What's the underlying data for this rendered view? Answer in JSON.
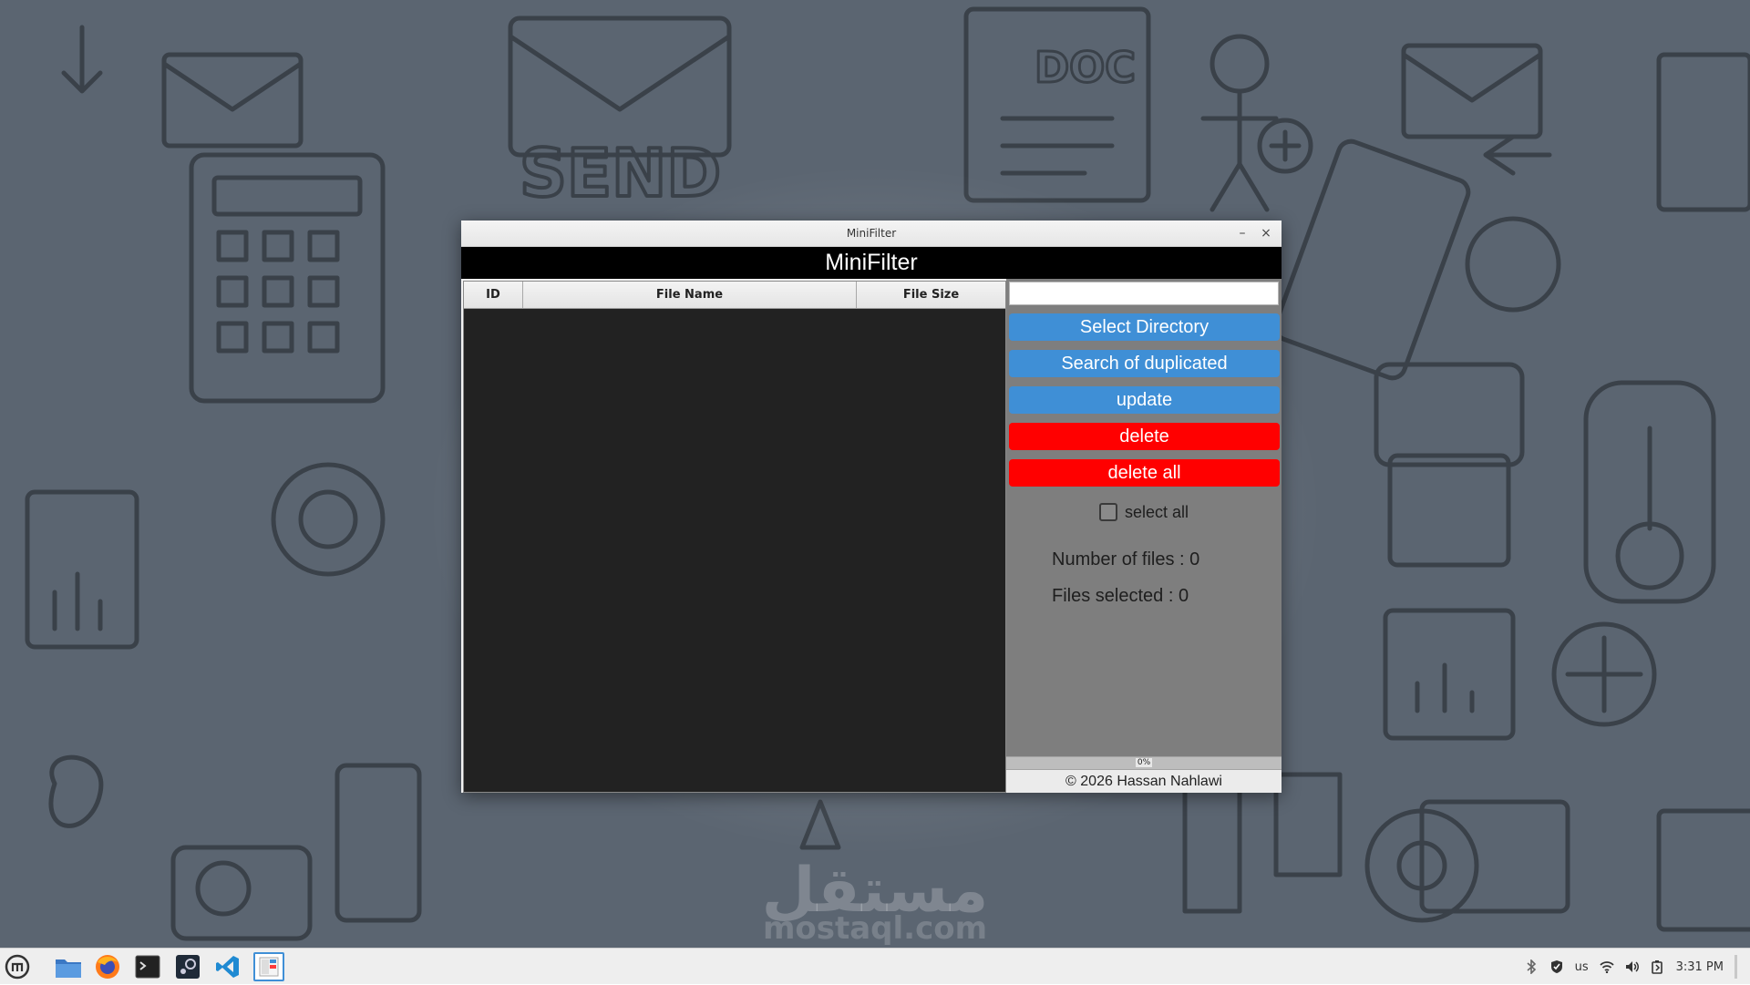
{
  "window": {
    "title": "MiniFilter",
    "minimize_glyph": "–",
    "close_glyph": "×"
  },
  "app": {
    "header": "MiniFilter"
  },
  "table": {
    "columns": [
      "ID",
      "File Name",
      "File Size"
    ],
    "rows": []
  },
  "side": {
    "search": {
      "value": "",
      "placeholder": ""
    },
    "buttons": {
      "select_directory": "Select Directory",
      "search_duplicated": "Search of duplicated",
      "update": "update",
      "delete": "delete",
      "delete_all": "delete all"
    },
    "select_all": {
      "label": "select all",
      "checked": false
    },
    "stats": {
      "number_of_files": "Number of files : 0",
      "files_selected": "Files selected : 0"
    },
    "progress": {
      "value": 0,
      "text": "0%"
    },
    "footer": "© 2026 Hassan Nahlawi"
  },
  "taskbar": {
    "apps": [
      "menu-icon",
      "files-icon",
      "firefox-icon",
      "terminal-icon",
      "steam-icon",
      "vscode-icon",
      "minifilter-icon"
    ],
    "tray": {
      "keyboard_layout": "us",
      "clock": "3:31 PM"
    }
  },
  "watermark": {
    "arabic": "مستقل",
    "latin": "mostaql.com"
  },
  "colors": {
    "blue_button": "#3f8fd6",
    "red_button": "#ff0000",
    "panel": "#7e7e7e",
    "table_bg": "#222222",
    "header_bg": "#000000"
  }
}
